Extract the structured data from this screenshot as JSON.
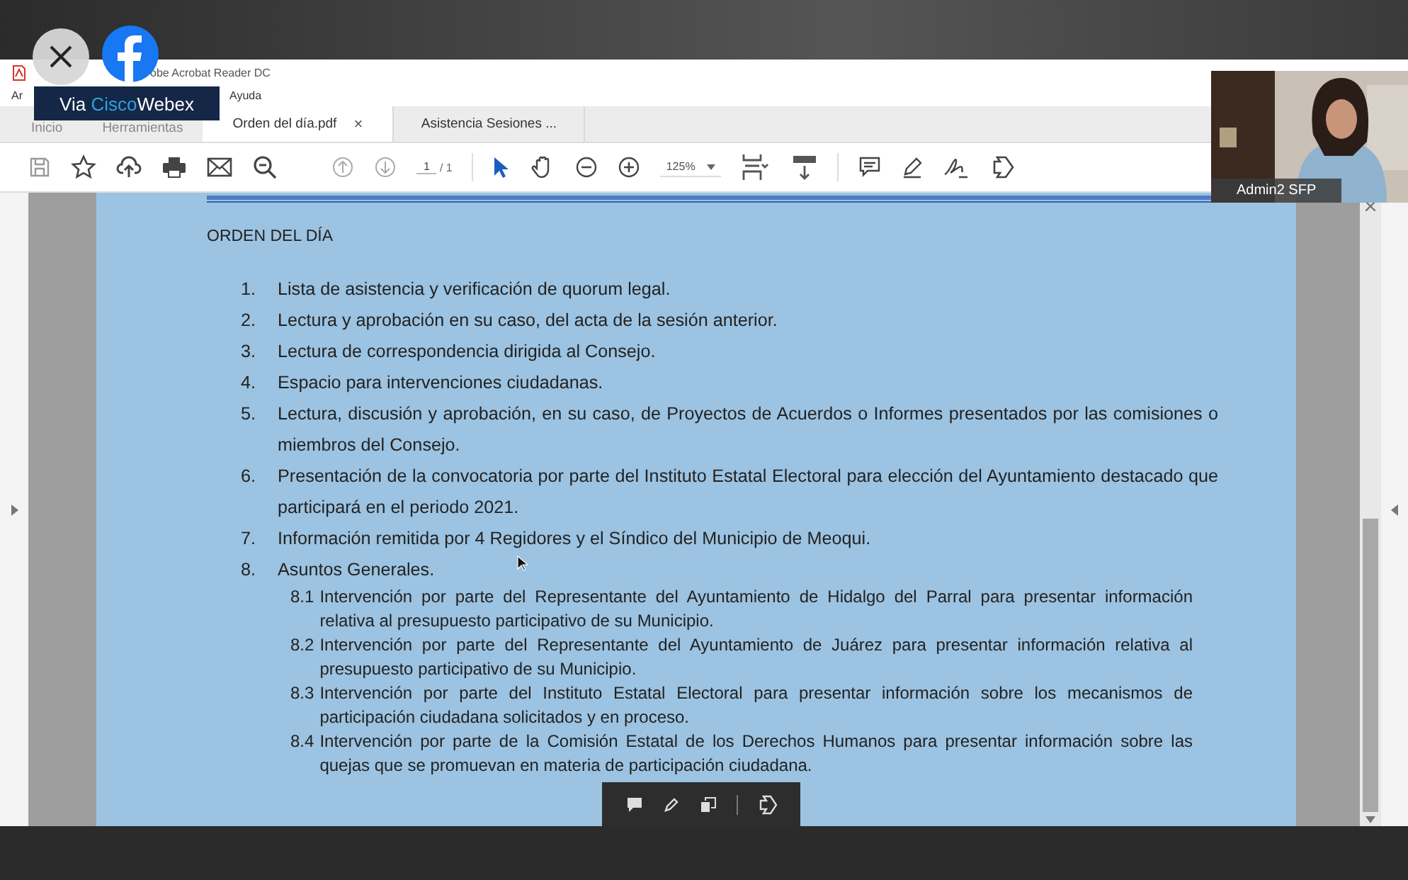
{
  "overlay": {
    "badge": {
      "via": "Via",
      "brand_a": "Cisco",
      "brand_b": "Webex"
    }
  },
  "window": {
    "title": "obe Acrobat Reader DC"
  },
  "menu": [
    "Ar",
    "Ayuda"
  ],
  "tabs": [
    {
      "label": "Inicio",
      "selected": false,
      "kind": "home"
    },
    {
      "label": "Herramientas",
      "selected": false,
      "kind": "home"
    },
    {
      "label": "Orden del día.pdf",
      "selected": true,
      "kind": "document",
      "close": "×"
    },
    {
      "label": "Asistencia Sesiones ...",
      "selected": false,
      "kind": "document"
    }
  ],
  "toolbar": {
    "page": "1",
    "pages": "/ 1",
    "zoom": "125%"
  },
  "document": {
    "heading": "ORDEN DEL DÍA",
    "items": [
      {
        "number": "1.",
        "text": "Lista de asistencia y verificación de quorum legal."
      },
      {
        "number": "2.",
        "text": "Lectura y aprobación en su caso, del acta de la sesión anterior."
      },
      {
        "number": "3.",
        "text": "Lectura de correspondencia dirigida al Consejo."
      },
      {
        "number": "4.",
        "text": "Espacio para intervenciones ciudadanas."
      },
      {
        "number": "5.",
        "text": "Lectura, discusión y aprobación, en su caso, de Proyectos de Acuerdos o Informes presentados por las comisiones o miembros del Consejo."
      },
      {
        "number": "6.",
        "text": "Presentación de la convocatoria por parte del Instituto Estatal Electoral para elección del Ayuntamiento destacado que participará en el periodo 2021."
      },
      {
        "number": "7.",
        "text": "Información remitida por 4 Regidores y el Síndico del Municipio de Meoqui."
      },
      {
        "number": "8.",
        "text": "Asuntos Generales.",
        "children": [
          {
            "number": "8.1",
            "text": "Intervención por parte del Representante del Ayuntamiento de Hidalgo del Parral para presentar información relativa al presupuesto participativo de su Municipio."
          },
          {
            "number": "8.2",
            "text": "Intervención por parte del Representante del Ayuntamiento de Juárez para presentar información relativa al presupuesto participativo de su Municipio."
          },
          {
            "number": "8.3",
            "text": "Intervención por parte del Instituto Estatal Electoral para presentar información sobre los mecanismos de participación ciudadana solicitados y en proceso."
          },
          {
            "number": "8.4",
            "text": "Intervención por parte de la Comisión Estatal de los Derechos Humanos para presentar información sobre las quejas que se promuevan en materia de participación ciudadana."
          }
        ]
      }
    ]
  },
  "video": {
    "name": "Admin2 SFP"
  }
}
